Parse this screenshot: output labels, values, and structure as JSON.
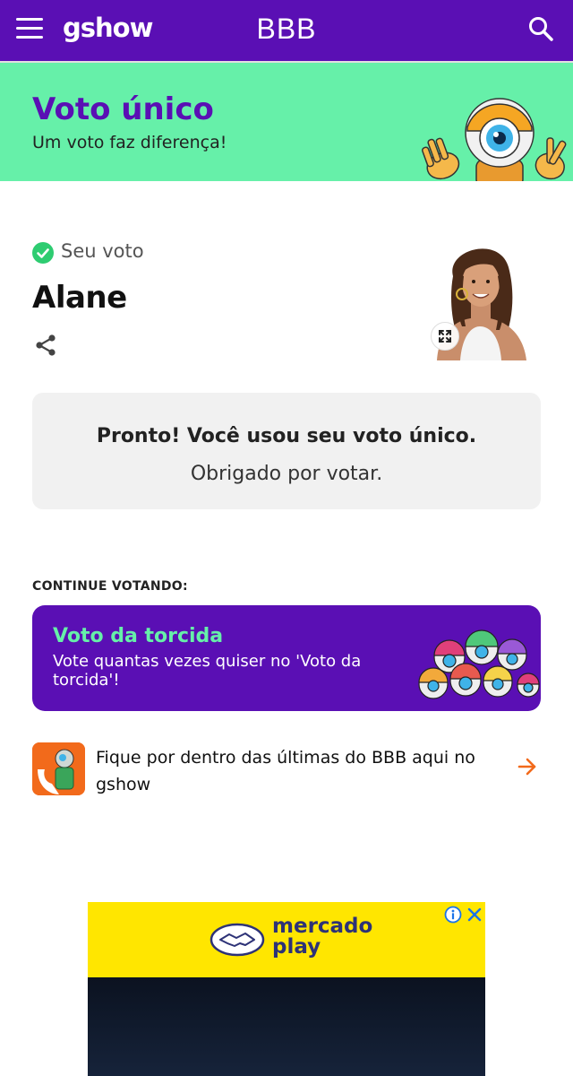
{
  "header": {
    "menu_icon": "hamburger-menu-icon",
    "logo_text": "gshow",
    "section_title": "BBB",
    "search_icon": "search-icon",
    "background_color": "#5a0fb4"
  },
  "banner": {
    "title": "Voto único",
    "subtitle": "Um voto faz diferença!",
    "background_color": "#66f0a9",
    "title_color": "#5a0fb4",
    "mascot_icon": "bbb-eye-mascot-icon"
  },
  "vote": {
    "status_label": "Seu voto",
    "status_icon": "check-circle-icon",
    "candidate_name": "Alane",
    "share_icon": "share-icon",
    "expand_icon": "expand-icon"
  },
  "confirmation": {
    "bold_text": "Pronto! Você usou seu voto único.",
    "regular_text": " Obrigado por votar."
  },
  "continue_section": {
    "label": "CONTINUE VOTANDO:",
    "card_title": "Voto da torcida",
    "card_description": "Vote quantas vezes quiser no 'Voto da torcida'!",
    "card_color": "#5a0fb4",
    "card_title_color": "#66f0a9"
  },
  "news_link": {
    "text": "Fique por dentro das últimas do BBB aqui no gshow",
    "arrow_icon": "arrow-right-icon",
    "arrow_color": "#f26a1b"
  },
  "ad": {
    "brand_line1": "mercado",
    "brand_line2": "play",
    "info_icon": "info-icon",
    "close_icon": "close-icon",
    "background_color": "#ffe600"
  }
}
